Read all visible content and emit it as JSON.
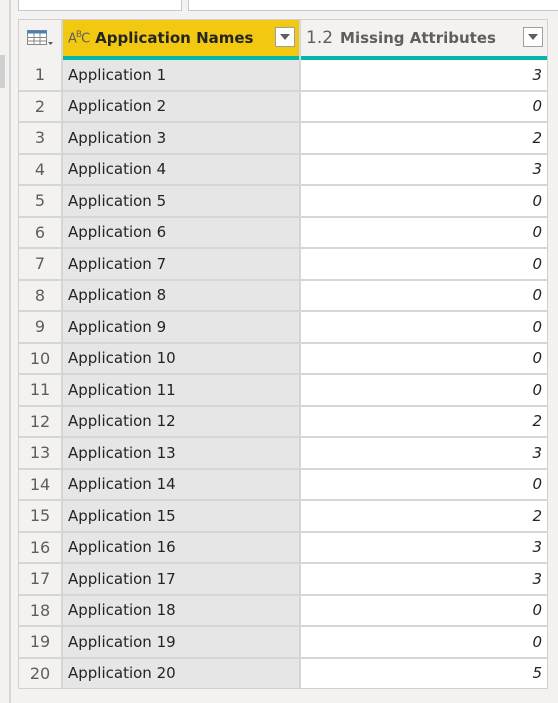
{
  "table": {
    "columns": [
      {
        "type_icon": "ABC",
        "label": "Application Names",
        "type": "text"
      },
      {
        "type_icon": "1.2",
        "label": "Missing Attributes",
        "type": "decimal"
      }
    ],
    "rows": [
      {
        "index": "1",
        "name": "Application 1",
        "value": "3"
      },
      {
        "index": "2",
        "name": "Application 2",
        "value": "0"
      },
      {
        "index": "3",
        "name": "Application 3",
        "value": "2"
      },
      {
        "index": "4",
        "name": "Application 4",
        "value": "3"
      },
      {
        "index": "5",
        "name": "Application 5",
        "value": "0"
      },
      {
        "index": "6",
        "name": "Application 6",
        "value": "0"
      },
      {
        "index": "7",
        "name": "Application 7",
        "value": "0"
      },
      {
        "index": "8",
        "name": "Application 8",
        "value": "0"
      },
      {
        "index": "9",
        "name": "Application 9",
        "value": "0"
      },
      {
        "index": "10",
        "name": "Application 10",
        "value": "0"
      },
      {
        "index": "11",
        "name": "Application 11",
        "value": "0"
      },
      {
        "index": "12",
        "name": "Application 12",
        "value": "2"
      },
      {
        "index": "13",
        "name": "Application 13",
        "value": "3"
      },
      {
        "index": "14",
        "name": "Application 14",
        "value": "0"
      },
      {
        "index": "15",
        "name": "Application 15",
        "value": "2"
      },
      {
        "index": "16",
        "name": "Application 16",
        "value": "3"
      },
      {
        "index": "17",
        "name": "Application 17",
        "value": "3"
      },
      {
        "index": "18",
        "name": "Application 18",
        "value": "0"
      },
      {
        "index": "19",
        "name": "Application 19",
        "value": "0"
      },
      {
        "index": "20",
        "name": "Application 20",
        "value": "5"
      }
    ]
  },
  "colors": {
    "selected_header": "#f2c811",
    "quality_bar": "#01b8aa"
  }
}
